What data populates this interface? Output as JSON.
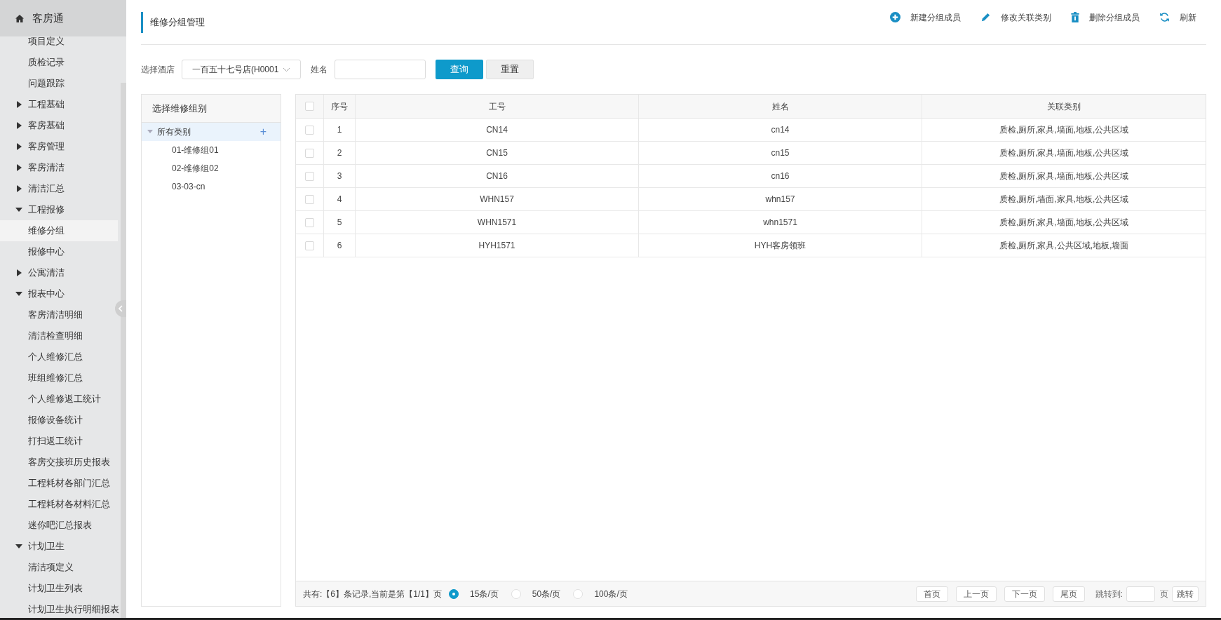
{
  "sidebar": {
    "title": "客房通",
    "items": [
      {
        "kind": "leaf",
        "label": "项目定义",
        "selected": false
      },
      {
        "kind": "leaf",
        "label": "质检记录",
        "selected": false
      },
      {
        "kind": "leaf",
        "label": "问题跟踪",
        "selected": false
      },
      {
        "kind": "section",
        "label": "工程基础",
        "expanded": false
      },
      {
        "kind": "section",
        "label": "客房基础",
        "expanded": false
      },
      {
        "kind": "section",
        "label": "客房管理",
        "expanded": false
      },
      {
        "kind": "section",
        "label": "客房清洁",
        "expanded": false
      },
      {
        "kind": "section",
        "label": "清洁汇总",
        "expanded": false
      },
      {
        "kind": "section",
        "label": "工程报修",
        "expanded": true,
        "children": [
          {
            "kind": "leaf",
            "label": "维修分组",
            "selected": true
          },
          {
            "kind": "leaf",
            "label": "报修中心",
            "selected": false
          }
        ]
      },
      {
        "kind": "section",
        "label": "公寓清洁",
        "expanded": false
      },
      {
        "kind": "section",
        "label": "报表中心",
        "expanded": true,
        "children": [
          {
            "kind": "leaf",
            "label": "客房清洁明细",
            "selected": false
          },
          {
            "kind": "leaf",
            "label": "清洁检查明细",
            "selected": false
          },
          {
            "kind": "leaf",
            "label": "个人维修汇总",
            "selected": false
          },
          {
            "kind": "leaf",
            "label": "班组维修汇总",
            "selected": false
          },
          {
            "kind": "leaf",
            "label": "个人维修返工统计",
            "selected": false
          },
          {
            "kind": "leaf",
            "label": "报修设备统计",
            "selected": false
          },
          {
            "kind": "leaf",
            "label": "打扫返工统计",
            "selected": false
          },
          {
            "kind": "leaf",
            "label": "客房交接班历史报表",
            "selected": false
          },
          {
            "kind": "leaf",
            "label": "工程耗材各部门汇总",
            "selected": false
          },
          {
            "kind": "leaf",
            "label": "工程耗材各材料汇总",
            "selected": false
          },
          {
            "kind": "leaf",
            "label": "迷你吧汇总报表",
            "selected": false
          }
        ]
      },
      {
        "kind": "section",
        "label": "计划卫生",
        "expanded": true,
        "children": [
          {
            "kind": "leaf",
            "label": "清洁项定义",
            "selected": false
          },
          {
            "kind": "leaf",
            "label": "计划卫生列表",
            "selected": false
          },
          {
            "kind": "leaf",
            "label": "计划卫生执行明细报表",
            "selected": false
          }
        ]
      }
    ]
  },
  "page_title": "维修分组管理",
  "toolbar": [
    {
      "kind": "add",
      "label": "新建分组成员"
    },
    {
      "kind": "edit",
      "label": "修改关联类别"
    },
    {
      "kind": "delete",
      "label": "删除分组成员"
    },
    {
      "kind": "refresh",
      "label": "刷新"
    }
  ],
  "filters": {
    "hotel_label": "选择酒店",
    "hotel_value": "一百五十七号店(H0001",
    "name_label": "姓名",
    "query_button": "查询",
    "reset_button": "重置"
  },
  "group_panel": {
    "title": "选择维修组别",
    "root": {
      "label": "所有类别",
      "expanded": true,
      "selected": true,
      "add": "+",
      "children": [
        {
          "label": "01-维修组01"
        },
        {
          "label": "02-维修组02"
        },
        {
          "label": "03-03-cn"
        }
      ]
    }
  },
  "table": {
    "all_checked": false,
    "columns": [
      "序号",
      "工号",
      "姓名",
      "关联类别"
    ],
    "rows": [
      {
        "checked": false,
        "cells": [
          "1",
          "CN14",
          "cn14",
          "质检,厕所,家具,墙面,地板,公共区域"
        ]
      },
      {
        "checked": false,
        "cells": [
          "2",
          "CN15",
          "cn15",
          "质检,厕所,家具,墙面,地板,公共区域"
        ]
      },
      {
        "checked": false,
        "cells": [
          "3",
          "CN16",
          "cn16",
          "质检,厕所,家具,墙面,地板,公共区域"
        ]
      },
      {
        "checked": false,
        "cells": [
          "4",
          "WHN157",
          "whn157",
          "质检,厕所,墙面,家具,地板,公共区域"
        ]
      },
      {
        "checked": false,
        "cells": [
          "5",
          "WHN1571",
          "whn1571",
          "质检,厕所,家具,墙面,地板,公共区域"
        ]
      },
      {
        "checked": false,
        "cells": [
          "6",
          "HYH1571",
          "HYH客房领班",
          "质检,厕所,家具,公共区域,地板,墙面"
        ]
      }
    ]
  },
  "pager": {
    "summary": "共有:【6】条记录,当前是第【1/1】页",
    "sizes": [
      {
        "label": "15条/页",
        "selected": true
      },
      {
        "label": "50条/页",
        "selected": false
      },
      {
        "label": "100条/页",
        "selected": false
      }
    ],
    "buttons": [
      "首页",
      "上一页",
      "下一页",
      "尾页"
    ],
    "jump_label": "跳转到:",
    "page_unit": "页",
    "jump_button": "跳转"
  }
}
